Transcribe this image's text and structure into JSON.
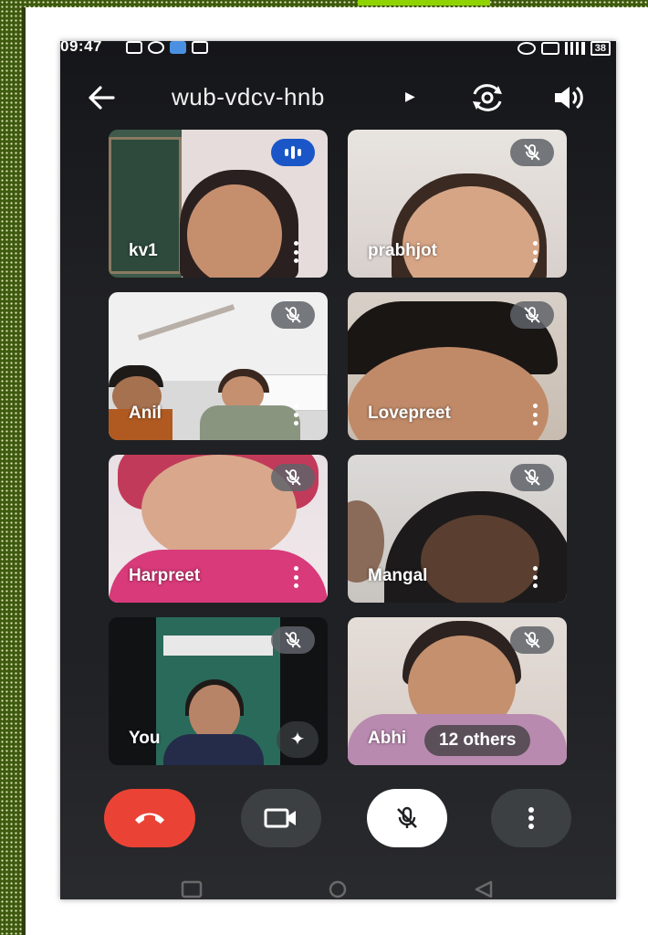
{
  "status_bar": {
    "time": "09:47",
    "battery": "38"
  },
  "header": {
    "meeting_code": "wub-vdcv-hnb",
    "back_icon": "arrow-left-icon",
    "flip_icon": "flip-camera-icon",
    "audio_icon": "speaker-icon"
  },
  "participants": [
    {
      "name": "kv1",
      "status": "speaking"
    },
    {
      "name": "prabhjot",
      "status": "muted"
    },
    {
      "name": "Anil",
      "status": "muted"
    },
    {
      "name": "Lovepreet",
      "status": "muted"
    },
    {
      "name": "Harpreet",
      "status": "muted"
    },
    {
      "name": "Mangal",
      "status": "muted"
    },
    {
      "name": "You",
      "status": "muted"
    },
    {
      "name": "Abhi",
      "status": "muted"
    }
  ],
  "overflow": {
    "label": "12 others"
  },
  "controls": {
    "end_call_icon": "end-call-icon",
    "camera_icon": "video-camera-icon",
    "mic_icon": "mic-off-icon",
    "more_icon": "more-vert-icon"
  },
  "colors": {
    "end_call": "#ea4335",
    "speaking_badge": "#1a56c7",
    "page_background": "#3d5a0e"
  }
}
